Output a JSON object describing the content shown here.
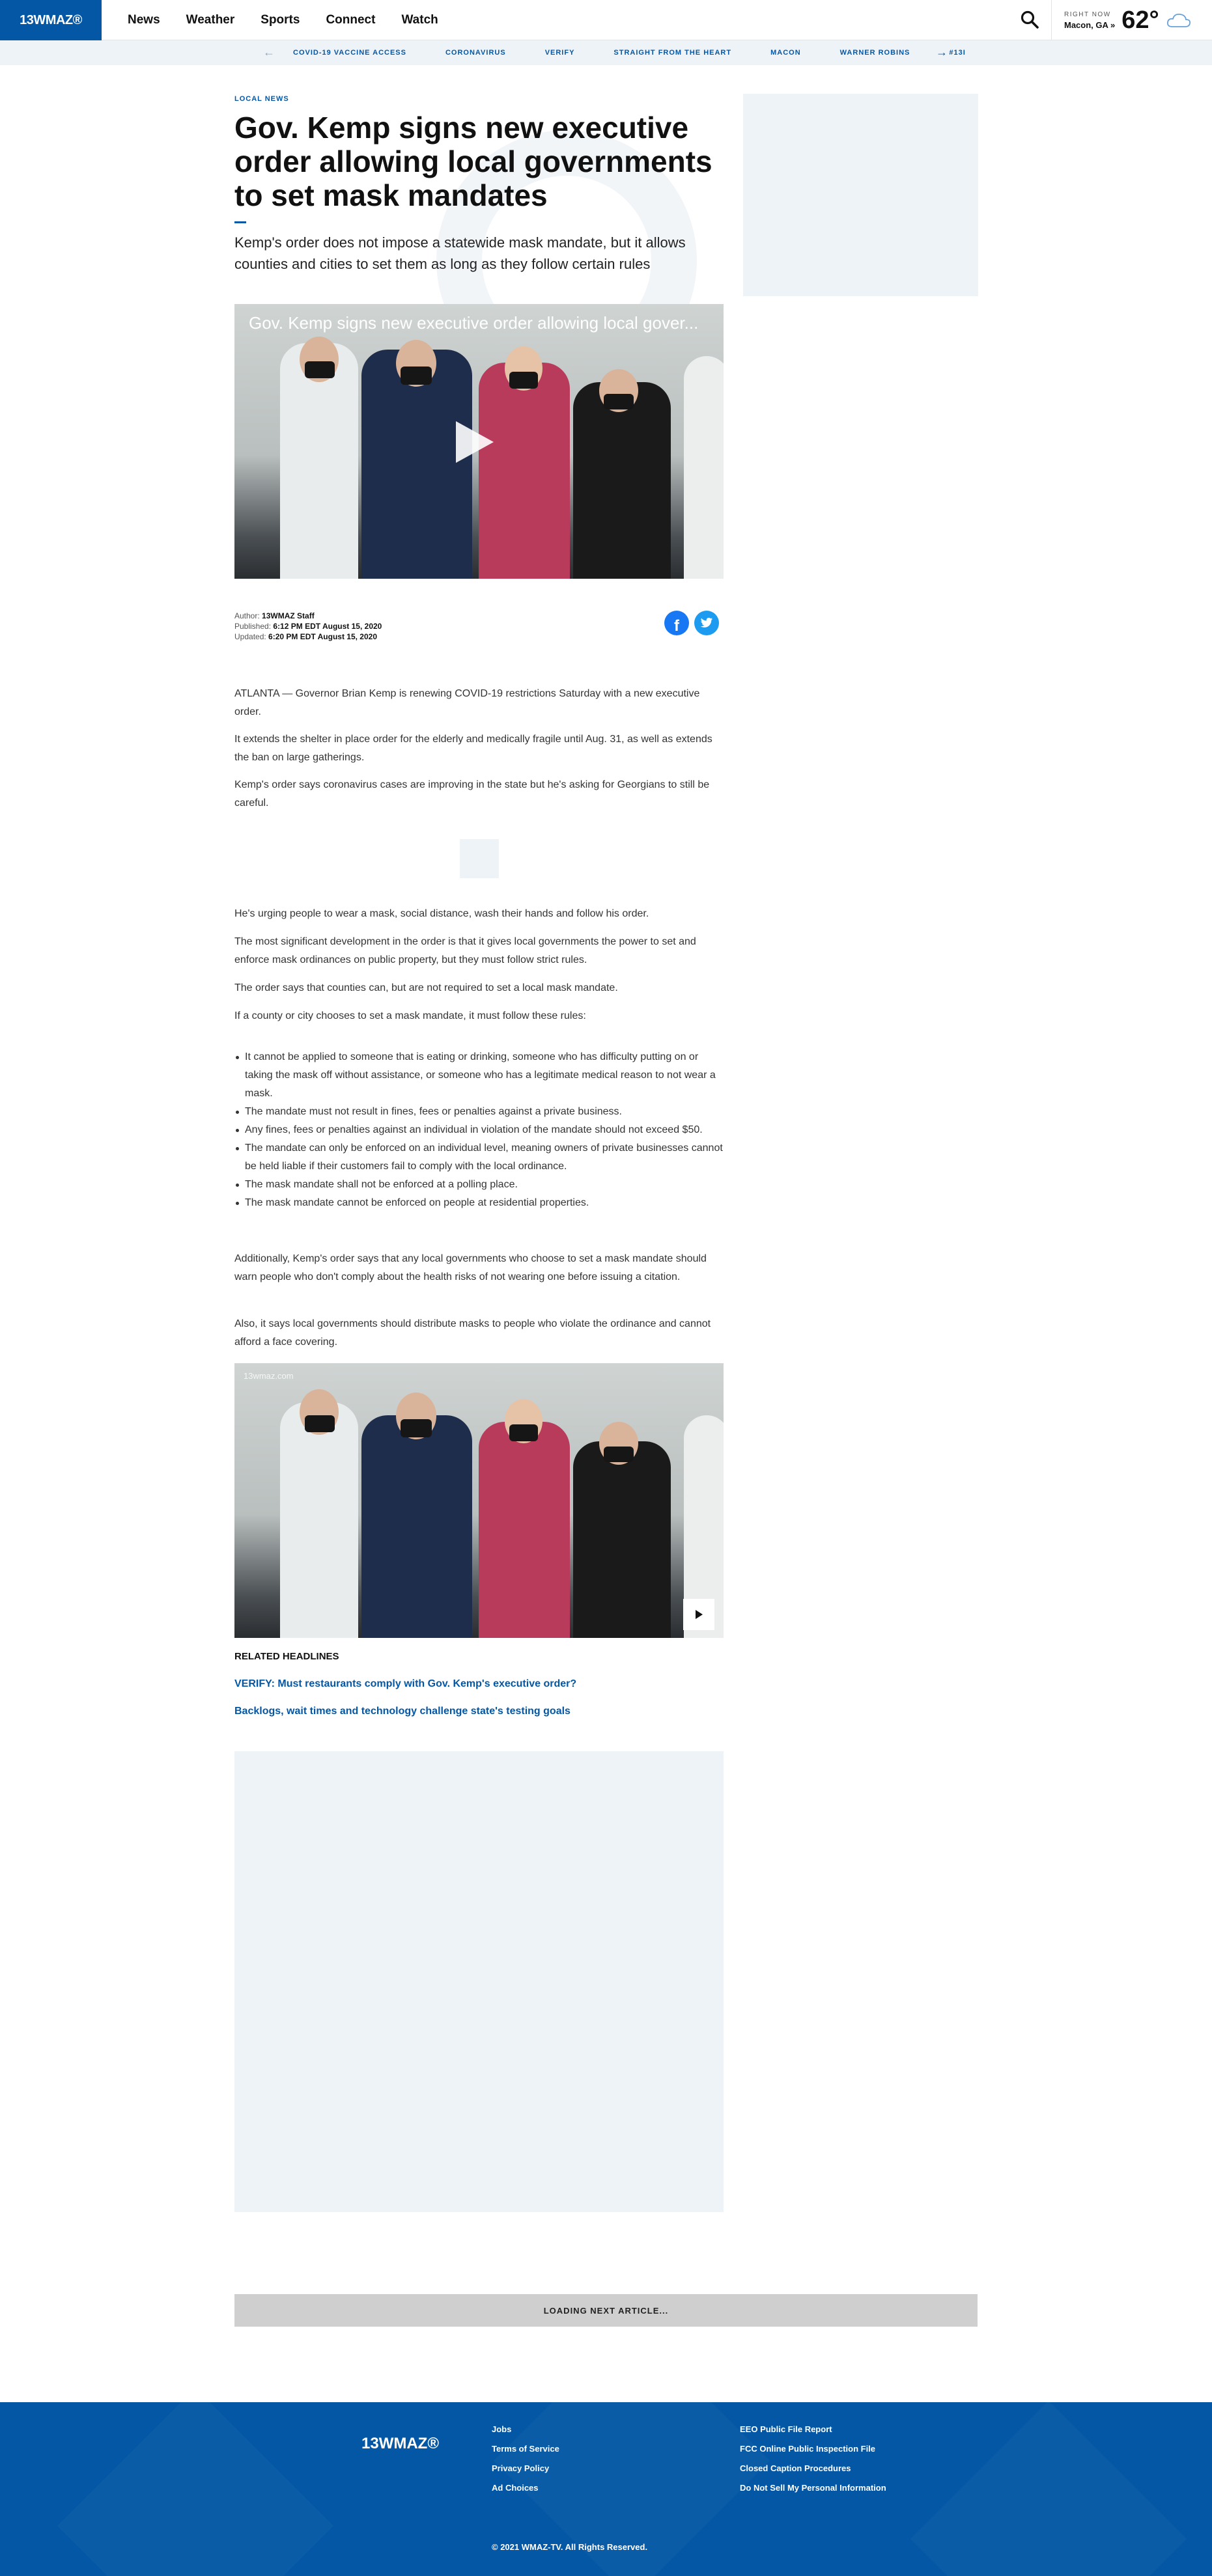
{
  "header": {
    "logo": "13WMAZ®",
    "nav": [
      "News",
      "Weather",
      "Sports",
      "Connect",
      "Watch"
    ],
    "weather": {
      "label": "RIGHT NOW",
      "location": "Macon, GA »",
      "temp": "62°"
    }
  },
  "topics": [
    "COVID-19 VACCINE ACCESS",
    "CORONAVIRUS",
    "VERIFY",
    "STRAIGHT FROM THE HEART",
    "MACON",
    "WARNER ROBINS",
    "#13I"
  ],
  "article": {
    "kicker": "LOCAL NEWS",
    "headline": "Gov. Kemp signs new executive order allowing local governments to set mask mandates",
    "dek": "Kemp's order does not impose a statewide mask mandate, but it allows counties and cities to set them as long as they follow certain rules",
    "video_title": "Gov. Kemp signs new executive order allowing local gover...",
    "byline": {
      "author_label": "Author:",
      "author": "13WMAZ Staff",
      "published_label": "Published:",
      "published": "6:12 PM EDT August 15, 2020",
      "updated_label": "Updated:",
      "updated": "6:20 PM EDT August 15, 2020"
    },
    "paragraphs": [
      "ATLANTA — Governor Brian Kemp is renewing COVID-19 restrictions Saturday with a new executive order.",
      "It extends the shelter in place order for the elderly and medically fragile until Aug. 31, as well as extends the ban on large gatherings.",
      "Kemp's order says coronavirus cases are improving in the state but he's asking for Georgians to still be careful.",
      "He's urging people to wear a mask, social distance, wash their hands and follow his order.",
      "The most significant development in the order is that it gives local governments the power to set and enforce mask ordinances on public property, but they must follow strict rules.",
      "The order says that counties can, but are not required to set a local mask mandate.",
      "If a county or city chooses to set a mask mandate, it must follow these rules:",
      "Additionally, Kemp's order says that any local governments who choose to set a mask mandate should warn people who don't comply about the health risks of not wearing one before issuing a citation.",
      "Also, it says local governments should distribute masks to people who violate the ordinance and cannot afford a face covering."
    ],
    "rules": [
      "It cannot be applied to someone that is eating or drinking, someone who has difficulty putting on or taking the mask off without assistance, or someone who has a legitimate medical reason to not wear a mask.",
      "The mandate must not result in fines, fees or penalties against a private business.",
      "Any fines, fees or penalties against an individual in violation of the mandate should not exceed $50.",
      "The mandate can only be enforced on an individual level, meaning owners of private businesses cannot be held liable if their customers fail to comply with the local ordinance.",
      "The mask mandate shall not be enforced at a polling place.",
      "The mask mandate cannot be enforced on people at residential properties."
    ],
    "video2_watermark": "13wmaz.com",
    "related_heading": "RELATED HEADLINES",
    "related": [
      "VERIFY: Must restaurants comply with Gov. Kemp's executive order?",
      "Backlogs, wait times and technology challenge state's testing goals"
    ],
    "loading": "LOADING NEXT ARTICLE..."
  },
  "footer": {
    "logo": "13WMAZ®",
    "col1": [
      "Jobs",
      "Terms of Service",
      "Privacy Policy",
      "Ad Choices"
    ],
    "col2": [
      "EEO Public File Report",
      "FCC Online Public Inspection File",
      "Closed Caption Procedures",
      "Do Not Sell My Personal Information"
    ],
    "copyright": "© 2021 WMAZ-TV. All Rights Reserved."
  },
  "colors": {
    "brand": "#0457a5",
    "topic_bg": "#eef3f8"
  }
}
